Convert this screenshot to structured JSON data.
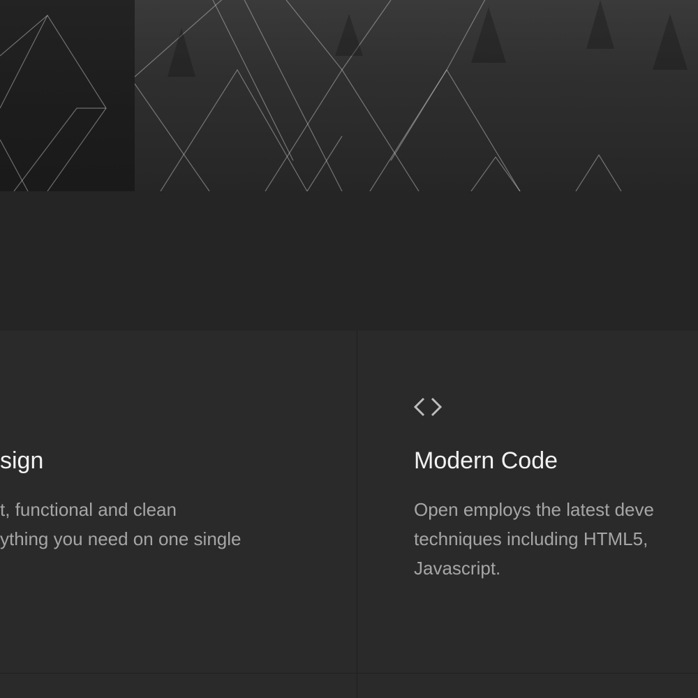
{
  "features": [
    {
      "title": "sign",
      "text_lines": [
        "t, functional and clean",
        "ything you need on one single"
      ]
    },
    {
      "icon": "code-brackets-icon",
      "title": "Modern Code",
      "text_lines": [
        "Open employs the latest deve",
        "techniques including HTML5,",
        "Javascript."
      ]
    }
  ],
  "colors": {
    "background": "#252525",
    "card": "#2a2a2a",
    "title": "#f2f2f2",
    "body_text": "#a6a6a6"
  }
}
